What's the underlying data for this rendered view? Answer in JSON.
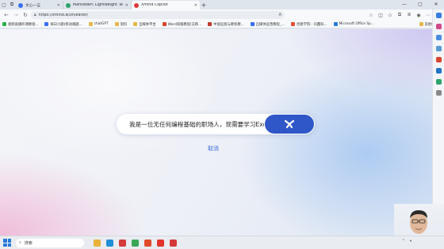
{
  "browser": {
    "tabs": [
      {
        "title": "文心一言",
        "favicon_color": "#3b6ef5",
        "active": false
      },
      {
        "title": "Markdown: Lightweight Text For...",
        "favicon_color": "#2fa36b",
        "active": false
      },
      {
        "title": "Xmind Copilot",
        "favicon_color": "#e03a3a",
        "active": true
      }
    ],
    "new_tab_icon": "plus-icon",
    "url": "https://xmind.ai/zh/editor/"
  },
  "bookmarks": [
    {
      "label": "视频直播听课教程...",
      "color": "#2bb24c"
    },
    {
      "label": "每日小题(移动端题...",
      "color": "#3b6ef5"
    },
    {
      "label": "chatGPT",
      "color": "#e6b84a"
    },
    {
      "label": "资料",
      "color": "#e6b84a"
    },
    {
      "label": "自媒体平台",
      "color": "#e6b84a"
    },
    {
      "label": "Word排版教程(又称...",
      "color": "#d8452f"
    },
    {
      "label": "中国远程与继续教...",
      "color": "#c0392b"
    },
    {
      "label": "自媒体运营教程_...",
      "color": "#3b6ef5"
    },
    {
      "label": "创意学院 - 讯鑫科...",
      "color": "#e04f3a"
    },
    {
      "label": "Microsoft Office Sp...",
      "color": "#2a7ad8"
    },
    {
      "label": "其他收藏夹",
      "color": "#e6b84a"
    }
  ],
  "main": {
    "prompt_text": "我是一位无任何编程基础的职场人，现需要学习Exc...",
    "go_button_icon": "xmind-logo-icon",
    "cancel_label": "取消",
    "accent_color": "#2f57c8"
  },
  "sidebar_icons": [
    {
      "name": "search-icon",
      "color": "#3a7be0"
    },
    {
      "name": "bag-icon",
      "color": "#d04a8a"
    },
    {
      "name": "tools-icon",
      "color": "#4a8be0"
    },
    {
      "name": "game-icon",
      "color": "#5a9ad0"
    },
    {
      "name": "office-icon",
      "color": "#d8452f"
    },
    {
      "name": "outlook-icon",
      "color": "#1f73c8"
    },
    {
      "name": "app-icon",
      "color": "#2fa36b"
    },
    {
      "name": "plus-icon",
      "color": "#888888"
    }
  ],
  "taskbar": {
    "search_placeholder": "搜索",
    "apps": [
      {
        "name": "file-explorer-icon",
        "color": "#e8b339"
      },
      {
        "name": "edge-icon",
        "color": "#1f8fd8"
      },
      {
        "name": "wps-writer-icon",
        "color": "#d43b3b"
      },
      {
        "name": "chrome-icon",
        "color": "#3aa757"
      },
      {
        "name": "wps-icon",
        "color": "#e04a2a"
      },
      {
        "name": "wps-pdf-icon",
        "color": "#e0332a"
      },
      {
        "name": "xmind-icon",
        "color": "#d43838"
      }
    ]
  }
}
